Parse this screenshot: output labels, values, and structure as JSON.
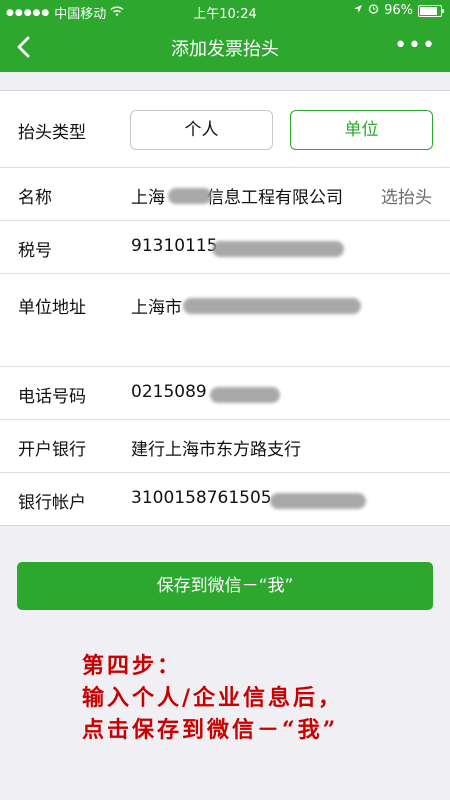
{
  "status_bar": {
    "carrier": "中国移动",
    "time": "上午10:24",
    "battery": "96%",
    "battery_level": 0.96
  },
  "nav": {
    "title": "添加发票抬头",
    "back_icon": "chevron-left-icon",
    "more_icon": "more-icon"
  },
  "form": {
    "header_type": {
      "label": "抬头类型",
      "options": [
        "个人",
        "单位"
      ],
      "selected": "单位"
    },
    "name": {
      "label": "名称",
      "value_prefix": "上海",
      "value_suffix": "信息工程有限公司",
      "action": "选抬头"
    },
    "tax_id": {
      "label": "税号",
      "value": "91310115"
    },
    "address": {
      "label": "单位地址",
      "value": "上海市"
    },
    "phone": {
      "label": "电话号码",
      "value": "0215089"
    },
    "bank": {
      "label": "开户银行",
      "value": "建行上海市东方路支行"
    },
    "account": {
      "label": "银行帐户",
      "value": "3100158761505"
    }
  },
  "save_button": {
    "label": "保存到微信－“我”"
  },
  "annotation": {
    "line1": "第四步：",
    "line2": "输入个人/企业信息后，",
    "line3": "点击保存到微信－“我”"
  },
  "colors": {
    "brand_green": "#2ea72f",
    "annotation_red": "#c80000"
  }
}
